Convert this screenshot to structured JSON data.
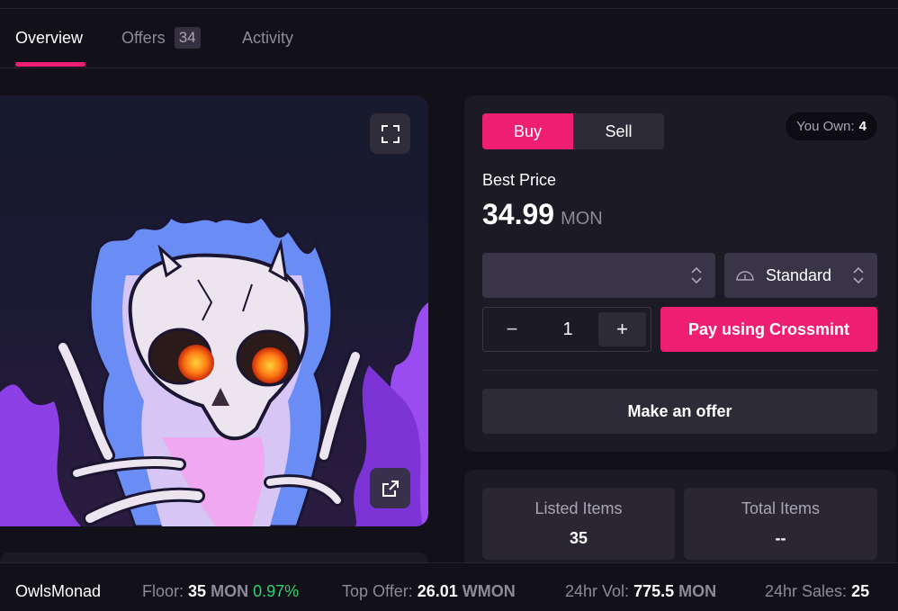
{
  "tabs": [
    {
      "label": "Overview",
      "active": true
    },
    {
      "label": "Offers",
      "count": "34"
    },
    {
      "label": "Activity"
    }
  ],
  "nft": {
    "expand_icon": "expand-icon",
    "external_icon": "external-link-icon"
  },
  "trade": {
    "buy_label": "Buy",
    "sell_label": "Sell",
    "you_own_label": "You Own:",
    "you_own_value": "4",
    "best_price_label": "Best Price",
    "price": "34.99",
    "price_unit": "MON",
    "select_value": "",
    "speed_label": "Standard",
    "quantity": "1",
    "minus_label": "−",
    "plus_label": "+",
    "pay_label": "Pay using Crossmint",
    "offer_label": "Make an offer"
  },
  "stats": [
    {
      "label": "Listed Items",
      "value": "35"
    },
    {
      "label": "Total Items",
      "value": "--"
    }
  ],
  "footer": {
    "collection": "OwlsMonad",
    "floor_label": "Floor:",
    "floor_value": "35",
    "floor_unit": "MON",
    "floor_change": "0.97%",
    "top_offer_label": "Top Offer:",
    "top_offer_value": "26.01",
    "top_offer_unit": "WMON",
    "vol_label": "24hr Vol:",
    "vol_value": "775.5",
    "vol_unit": "MON",
    "sales_label": "24hr Sales:",
    "sales_value": "25"
  },
  "colors": {
    "accent": "#ee1f73",
    "positive": "#2dd36f",
    "background": "#121019",
    "panel": "#1c1a24"
  }
}
